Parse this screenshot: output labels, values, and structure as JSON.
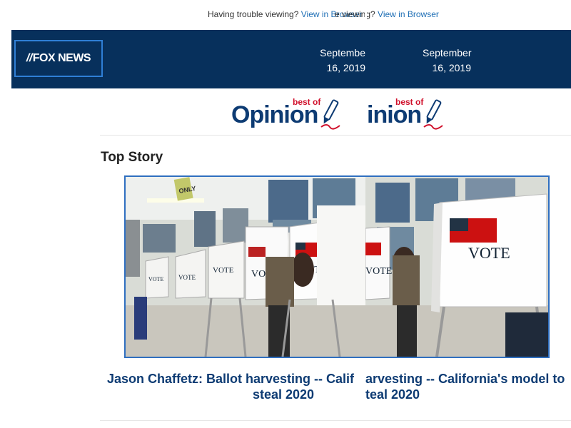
{
  "notice": {
    "left_text": "Having trouble viewing?",
    "left_link": "View in Browser",
    "right_text": "e viewing?",
    "right_link": "View in Browser"
  },
  "header": {
    "logo": "FOX NEWS",
    "date_left": [
      "Septembe",
      "16, 2019"
    ],
    "date_right": [
      "September",
      "16, 2019"
    ]
  },
  "banner": {
    "left_word": "Opinion",
    "right_word": "inion",
    "best_of": "best of"
  },
  "section": {
    "title": "Top Story"
  },
  "story": {
    "image_alt": "Voting booths with VOTE signs",
    "vote_label": "VOTE",
    "sign_label": "ONLY",
    "headline_left": [
      "Jason Chaffetz: Ballot harvesting -- Calif",
      "steal 2020"
    ],
    "headline_right": [
      "arvesting -- California's model to",
      "teal 2020"
    ]
  },
  "colors": {
    "header_bg": "#07305c",
    "headline": "#0d3b73",
    "link": "#1f6fb5",
    "accent_red": "#d0102b"
  }
}
